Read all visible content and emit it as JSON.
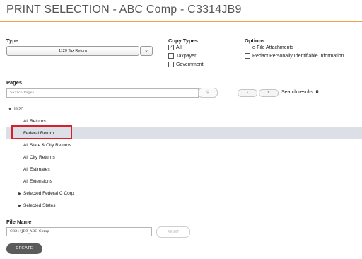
{
  "header": {
    "title": "PRINT SELECTION - ABC Comp - C3314JB9"
  },
  "type": {
    "label": "Type",
    "selected": "1120 Tax Return"
  },
  "copy_types": {
    "label": "Copy Types",
    "items": [
      {
        "label": "All",
        "checked": true
      },
      {
        "label": "Taxpayer",
        "checked": false
      },
      {
        "label": "Government",
        "checked": false
      }
    ]
  },
  "options": {
    "label": "Options",
    "items": [
      {
        "label": "e-File Attachments",
        "checked": false
      },
      {
        "label": "Redact Personally Identifiable Information",
        "checked": false
      }
    ]
  },
  "pages": {
    "label": "Pages",
    "search_placeholder": "Search Pages",
    "results_label": "Search results: ",
    "results_count": "0",
    "tree": [
      {
        "label": "1120",
        "toggle": "▼",
        "selected": false
      },
      {
        "label": "All Returns",
        "toggle": "",
        "selected": false
      },
      {
        "label": "Federal Return",
        "toggle": "",
        "selected": true
      },
      {
        "label": "All State & City Returns",
        "toggle": "",
        "selected": false
      },
      {
        "label": "All City Returns",
        "toggle": "",
        "selected": false
      },
      {
        "label": "All Estimates",
        "toggle": "",
        "selected": false
      },
      {
        "label": "All Extensions",
        "toggle": "",
        "selected": false
      },
      {
        "label": "Selected Federal C Corp",
        "toggle": "▶",
        "selected": false
      },
      {
        "label": "Selected States",
        "toggle": "▶",
        "selected": false
      }
    ]
  },
  "file_name": {
    "label": "File Name",
    "value": "C3314JB9_ABC Comp"
  },
  "buttons": {
    "reset": "RESET",
    "create": "CREATE"
  },
  "icons": {
    "dropdown": "chevron-down-icon",
    "search": "search-icon",
    "prev": "arrow-up-icon",
    "next": "arrow-down-icon"
  },
  "colors": {
    "accent": "#f0a24a",
    "highlight": "#d8202b",
    "selected_row": "#dcdfe6",
    "create_button": "#5b5b5b"
  }
}
